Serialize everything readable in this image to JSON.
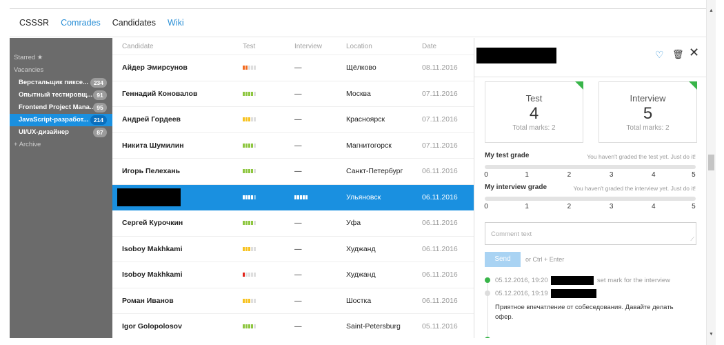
{
  "nav": {
    "brand": "CSSSR",
    "items": [
      "Comrades",
      "Candidates",
      "Wiki"
    ]
  },
  "sidebar": {
    "starred": "Starred ★",
    "vacancies": "Vacancies",
    "items": [
      {
        "label": "Верстальщик пиксе...",
        "count": "234"
      },
      {
        "label": "Опытный тестировщ...",
        "count": "91"
      },
      {
        "label": "Frontend Project Mana...",
        "count": "95"
      },
      {
        "label": "JavaScript-разработ...",
        "count": "214"
      },
      {
        "label": "UI/UX-дизайнер",
        "count": "87"
      }
    ],
    "archive": "+ Archive"
  },
  "list": {
    "columns": [
      "Candidate",
      "Test",
      "Interview",
      "Location",
      "Date"
    ],
    "rows": [
      {
        "name": "Айдер Эмирсунов",
        "test_level": 2,
        "test_color": "#f26b21",
        "interview": "—",
        "location": "Щёлково",
        "date": "08.11.2016"
      },
      {
        "name": "Геннадий Коновалов",
        "test_level": 4,
        "test_color": "#8dc63f",
        "interview": "—",
        "location": "Москва",
        "date": "07.11.2016"
      },
      {
        "name": "Андрей Гордеев",
        "test_level": 3,
        "test_color": "#f7c21f",
        "interview": "—",
        "location": "Красноярск",
        "date": "07.11.2016"
      },
      {
        "name": "Никита Шумилин",
        "test_level": 4,
        "test_color": "#8dc63f",
        "interview": "—",
        "location": "Магнитогорск",
        "date": "07.11.2016"
      },
      {
        "name": "Игорь Пелехань",
        "test_level": 4,
        "test_color": "#8dc63f",
        "interview": "—",
        "location": "Санкт-Петербург",
        "date": "06.11.2016"
      },
      {
        "name": "",
        "test_level": 4,
        "test_color": "#ffffff",
        "interview": "",
        "location": "Ульяновск",
        "date": "06.11.2016",
        "selected": true
      },
      {
        "name": "Сергей Курочкин",
        "test_level": 4,
        "test_color": "#8dc63f",
        "interview": "—",
        "location": "Уфа",
        "date": "06.11.2016"
      },
      {
        "name": "Isoboy Makhkami",
        "test_level": 3,
        "test_color": "#f7c21f",
        "interview": "—",
        "location": "Худжанд",
        "date": "06.11.2016"
      },
      {
        "name": "Isoboy Makhkami",
        "test_level": 1,
        "test_color": "#e2231a",
        "interview": "—",
        "location": "Худжанд",
        "date": "06.11.2016"
      },
      {
        "name": "Роман Иванов",
        "test_level": 3,
        "test_color": "#f7c21f",
        "interview": "—",
        "location": "Шостка",
        "date": "06.11.2016"
      },
      {
        "name": "Igor Golopolosov",
        "test_level": 4,
        "test_color": "#8dc63f",
        "interview": "—",
        "location": "Saint-Petersburg",
        "date": "05.11.2016"
      }
    ]
  },
  "detail": {
    "cards": [
      {
        "title": "Test",
        "value": "4",
        "sub": "Total marks: 2"
      },
      {
        "title": "Interview",
        "value": "5",
        "sub": "Total marks: 2"
      }
    ],
    "test_grade": {
      "label": "My test grade",
      "hint": "You haven't graded the test yet. Just do it!"
    },
    "interview_grade": {
      "label": "My interview grade",
      "hint": "You haven't graded the interview yet. Just do it!"
    },
    "scale": [
      "0",
      "1",
      "2",
      "3",
      "4",
      "5"
    ],
    "comment_placeholder": "Comment text",
    "send": "Send",
    "send_hint": "or Ctrl + Enter",
    "timeline": [
      {
        "time": "05.12.2016, 19:20",
        "action": "set mark for the interview"
      },
      {
        "time": "05.12.2016, 19:19",
        "text": "Приятное впечатление от собеседования. Давайте делать офер."
      }
    ]
  },
  "colors": {
    "accent": "#1a90e0",
    "sidebar": "#6b6b6b",
    "green": "#39b54a"
  },
  "icons": [
    "heart-icon",
    "trash-icon",
    "close-icon"
  ]
}
